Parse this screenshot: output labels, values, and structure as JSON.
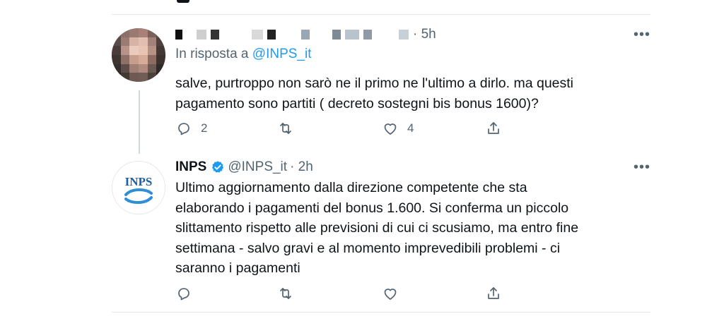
{
  "reply": {
    "name_blurred": "",
    "time": "· 5h",
    "replying_prefix": "In risposta a",
    "replying_handle": "@INPS_it",
    "text_line1": "salve, purtroppo non sarò ne il primo ne l'ultimo a dirlo. ma questi",
    "text_line2": "pagamento sono partiti ( decreto sostegni bis bonus 1600)?",
    "reply_count": "2",
    "like_count": "4",
    "more": "•••"
  },
  "inps": {
    "name": "INPS",
    "handle": "@INPS_it",
    "time": "· 2h",
    "logo_text": "INPS",
    "text_lines": [
      "Ultimo aggiornamento  dalla direzione competente che sta",
      "elaborando i pagamenti del bonus 1.600. Si conferma un piccolo",
      "slittamento rispetto alle previsioni di cui ci scusiamo, ma entro fine",
      "settimana - salvo gravi e al momento imprevedibili problemi - ci",
      "saranno i pagamenti"
    ],
    "more": "•••"
  },
  "colors": {
    "text": "#0f1419",
    "secondary": "#536471",
    "link": "#1d9bf0",
    "divider": "#e6e9ec",
    "inps_blue": "#1a5fa8"
  },
  "icons": [
    "reply-icon",
    "retweet-icon",
    "like-icon",
    "share-icon",
    "verified-badge-icon",
    "more-icon"
  ]
}
